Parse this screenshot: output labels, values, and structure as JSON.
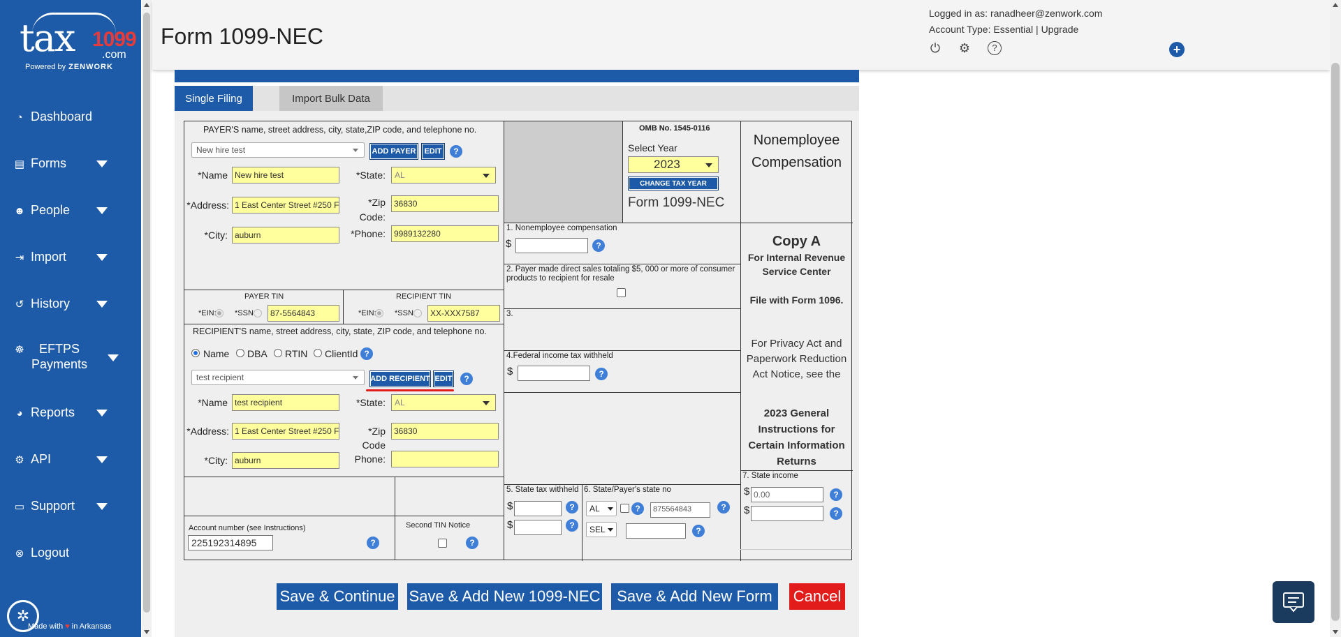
{
  "brand": {
    "logo_text": "tax",
    "logo_num": "1099",
    "logo_com": ".com",
    "powered_by": "Powered by",
    "powered_brand": "ZENWORK",
    "made_with_prefix": "Made with",
    "made_with_heart": "♥",
    "made_with_suffix": "in Arkansas"
  },
  "sidebar": {
    "items": [
      {
        "label": "Dashboard",
        "icon": "dashboard-icon"
      },
      {
        "label": "Forms",
        "icon": "forms-icon"
      },
      {
        "label": "People",
        "icon": "people-icon"
      },
      {
        "label": "Import",
        "icon": "import-icon"
      },
      {
        "label": "History",
        "icon": "history-icon"
      },
      {
        "label": "EFTPS Payments",
        "icon": "eftps-icon"
      },
      {
        "label": "Reports",
        "icon": "reports-icon"
      },
      {
        "label": "API",
        "icon": "api-icon"
      },
      {
        "label": "Support",
        "icon": "support-icon"
      },
      {
        "label": "Logout",
        "icon": "logout-icon"
      }
    ]
  },
  "header": {
    "title": "Form 1099-NEC",
    "logged_in": "Logged in as: ranadheer@zenwork.com",
    "account_type": "Account Type: Essential | Upgrade"
  },
  "tabs": {
    "single": "Single Filing",
    "bulk": "Import Bulk Data"
  },
  "payer": {
    "section_label": "PAYER'S name, street address, city, state,ZIP code, and telephone no.",
    "selected": "New hire test",
    "add_btn": "ADD PAYER",
    "edit_btn": "EDIT",
    "name_label": "*Name",
    "name": "New hire test",
    "state_label": "*State:",
    "state": "AL",
    "address_label": "*Address:",
    "address": "1 East Center Street #250 F",
    "zip_label": "*Zip",
    "zip_label2": "Code:",
    "zip": "36830",
    "city_label": "*City:",
    "city": "auburn",
    "phone_label": "*Phone:",
    "phone": "9989132280"
  },
  "tin": {
    "payer_label": "PAYER TIN",
    "recipient_label": "RECIPIENT TIN",
    "ein_label": "*EIN:",
    "ssn_label": "*SSN:",
    "payer_tin": "87-5564843",
    "recipient_tin": "XX-XXX7587"
  },
  "recipient": {
    "section_label": "RECIPIENT'S name, street address, city, state, ZIP code, and telephone no.",
    "radio_name": "Name",
    "radio_dba": "DBA",
    "radio_rtin": "RTIN",
    "radio_clientid": "ClientId",
    "selected": "test recipient",
    "add_btn": "ADD RECIPIENT",
    "edit_btn": "EDIT",
    "name_label": "*Name",
    "name": "test recipient",
    "state_label": "*State:",
    "state": "AL",
    "address_label": "*Address:",
    "address": "1 East Center Street #250 F",
    "zip_label": "*Zip",
    "zip_label2": "Code",
    "zip": "36830",
    "city_label": "*City:",
    "city": "auburn",
    "phone_label": "Phone:",
    "phone": ""
  },
  "account": {
    "label": "Account number (see Instructions)",
    "value": "225192314895",
    "second_tin_label": "Second TIN Notice"
  },
  "omb": {
    "number": "OMB No. 1545-0116",
    "select_year_label": "Select Year",
    "year": "2023",
    "change_btn": "CHANGE TAX YEAR",
    "form_name": "Form 1099-NEC"
  },
  "boxes": {
    "box1": "1. Nonemployee compensation",
    "box2": "2. Payer made direct sales totaling $5, 000 or more of consumer products to recipient for resale",
    "box3": "3.",
    "box4": "4.Federal income tax withheld",
    "box5": "5. State tax withheld",
    "box6": "6. State/Payer's state no",
    "box6_state1": "AL",
    "box6_state2": "SEL",
    "box6_no": "875564843",
    "box7": "7. State income",
    "box7_value": "0.00",
    "dollar": "$"
  },
  "right_panel": {
    "title1": "Nonemployee",
    "title2": "Compensation",
    "copy": "Copy A",
    "for_irs1": "For Internal Revenue",
    "for_irs2": "Service Center",
    "file_with": "File with Form 1096.",
    "privacy1": "For Privacy Act and",
    "privacy2": "Paperwork Reduction",
    "privacy3": "Act Notice, see the",
    "general1": "2023 General",
    "general2": "Instructions for",
    "general3": "Certain Information",
    "general4": "Returns"
  },
  "actions": {
    "save_continue": "Save & Continue",
    "save_add_nec": "Save & Add New 1099-NEC",
    "save_add_form": "Save & Add New  Form",
    "cancel": "Cancel"
  },
  "colors": {
    "brand_blue": "#1d5ba8",
    "field_yellow": "#ffff9e",
    "cancel_red": "#e21b1b"
  }
}
